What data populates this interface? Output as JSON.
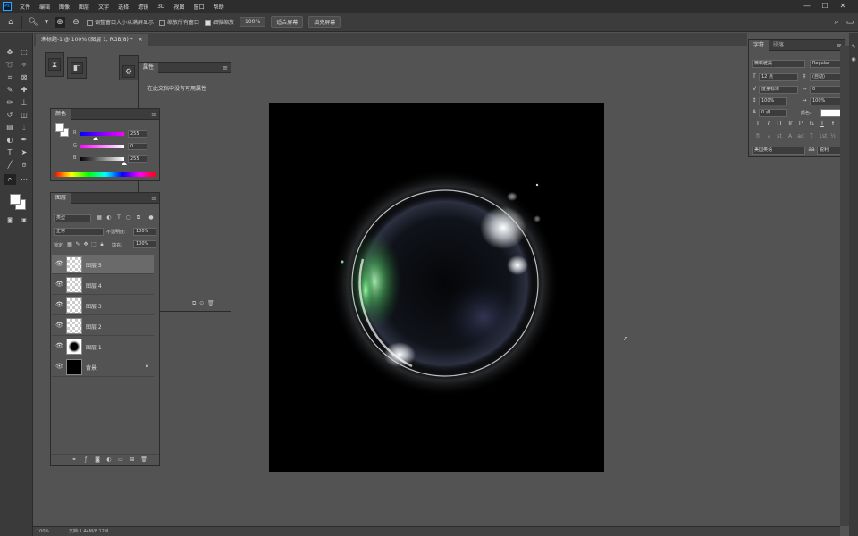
{
  "menubar": {
    "logo": "Ps",
    "items": [
      "文件",
      "编辑",
      "图像",
      "图层",
      "文字",
      "选择",
      "滤镜",
      "3D",
      "视图",
      "窗口",
      "帮助"
    ],
    "window_controls": [
      "—",
      "☐",
      "✕"
    ]
  },
  "options_bar": {
    "home_icon": "home-icon",
    "tool_icon": "zoom-icon",
    "checkbox_1": "调整窗口大小以满屏显示",
    "checkbox_2": "缩放所有窗口",
    "checkbox_3": "细微缩放",
    "zoom_value": "100%",
    "fit_screen": "适合屏幕",
    "fill_screen": "填充屏幕"
  },
  "document": {
    "tab_label": "未标题-1 @ 100% (图层 1, RGB/8) *",
    "close": "×"
  },
  "properties_panel": {
    "title": "属性",
    "text": "在此文档中没有可用属性",
    "menu": "≡"
  },
  "color_panel": {
    "title": "颜色",
    "r_label": "R",
    "g_label": "G",
    "b_label": "B",
    "r_value": "255",
    "g_value": "0",
    "b_value": "255",
    "menu": "≡"
  },
  "layers_panel": {
    "title": "图层",
    "kind_filter": "类型",
    "blend_mode": "正常",
    "opacity_label": "不透明度:",
    "opacity_value": "100%",
    "lock_label": "锁定:",
    "fill_label": "填充:",
    "fill_value": "100%",
    "menu": "≡",
    "layers": [
      {
        "name": "图层 5",
        "selected": true,
        "thumb": "checker"
      },
      {
        "name": "图层 4",
        "selected": false,
        "thumb": "checker"
      },
      {
        "name": "图层 3",
        "selected": false,
        "thumb": "checker"
      },
      {
        "name": "图层 2",
        "selected": false,
        "thumb": "checker"
      },
      {
        "name": "图层 1",
        "selected": false,
        "thumb": "ball"
      },
      {
        "name": "背景",
        "selected": false,
        "thumb": "black",
        "locked": true
      }
    ],
    "footer_icons": [
      "link-icon",
      "fx-icon",
      "mask-icon",
      "adjustment-icon",
      "folder-icon",
      "new-layer-icon",
      "trash-icon"
    ]
  },
  "character_panel": {
    "tab_1": "字符",
    "tab_2": "段落",
    "font_family": "微软雅黑",
    "font_style": "Regular",
    "font_size": "12 点",
    "leading": "(自动)",
    "kerning": "度量标准",
    "tracking": "0",
    "vertical_scale": "100%",
    "horizontal_scale": "100%",
    "baseline": "0 点",
    "color_label": "颜色:",
    "language": "美国英语",
    "antialias": "锐利",
    "style_buttons": [
      "T",
      "T",
      "TT",
      "Tr",
      "T¹",
      "T₁",
      "T",
      "Ŧ"
    ],
    "opentype_buttons": [
      "fi",
      "ℴ",
      "st",
      "A",
      "ad",
      "T",
      "1st",
      "½"
    ],
    "menu": "≡"
  },
  "status_bar": {
    "zoom": "100%",
    "doc_info": "文档:1.44M/8.12M"
  },
  "colors": {
    "ui_dark": "#2d2d2d",
    "ui_panel": "#535353",
    "canvas": "#000000",
    "highlight_green": "#6fcf7a",
    "accent_blue": "#31a8ff"
  }
}
